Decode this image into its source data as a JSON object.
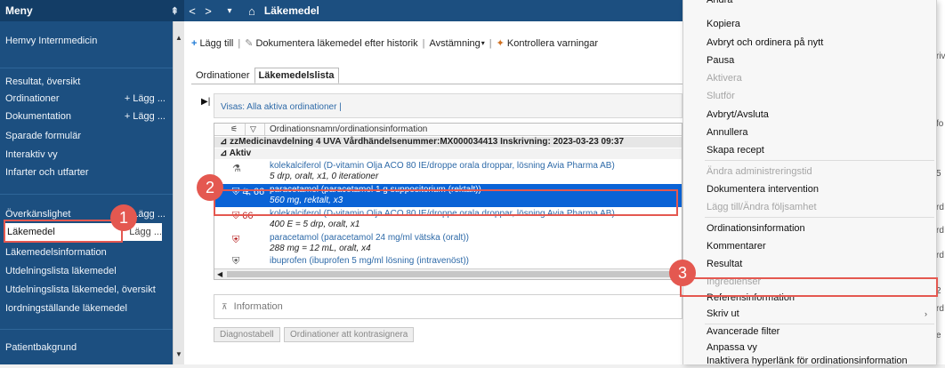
{
  "sidebar": {
    "title": "Meny",
    "pin": "⇞",
    "items": [
      {
        "label": "Hemvy Internmedicin",
        "add": ""
      },
      {
        "label": "Resultat, översikt",
        "add": ""
      },
      {
        "label": "Ordinationer",
        "add": "+ Lägg ..."
      },
      {
        "label": "Dokumentation",
        "add": "+ Lägg ..."
      },
      {
        "label": "Sparade formulär",
        "add": ""
      },
      {
        "label": "Interaktiv vy",
        "add": ""
      },
      {
        "label": "Infarter och utfarter",
        "add": ""
      },
      {
        "label": "Överkänslighet",
        "add": "Lägg ..."
      },
      {
        "label": "Läkemedel",
        "add": "Lägg ..."
      },
      {
        "label": "Läkemedelsinformation",
        "add": ""
      },
      {
        "label": "Utdelningslista läkemedel",
        "add": ""
      },
      {
        "label": "Utdelningslista läkemedel, översikt",
        "add": ""
      },
      {
        "label": "Iordningställande läkemedel",
        "add": ""
      },
      {
        "label": "Patientbakgrund",
        "add": ""
      }
    ]
  },
  "topbar": {
    "back": "<",
    "forward": ">",
    "dropdown": "▾",
    "home": "⌂",
    "title": "Läkemedel"
  },
  "toolbar": {
    "add": "Lägg till",
    "document": "Dokumentera läkemedel efter historik",
    "reconcile": "Avstämning",
    "reconcile_caret": "▾",
    "warnings": "Kontrollera varningar"
  },
  "tabs": {
    "orders": "Ordinationer",
    "medlist": "Läkemedelslista"
  },
  "filter": {
    "play": "▶|",
    "text": "Visas: Alla aktiva ordinationer |"
  },
  "grid": {
    "col1": "⚟",
    "col2": "▽",
    "col3": "Ordinationsnamn/ordinationsinformation",
    "group": "⊿  zzMedicinavdelning 4 UVA  Vårdhändelsenummer:MX000034413  Inskrivning: 2023-03-23 09:37",
    "subgroup": "⊿  Aktiv",
    "rows": [
      {
        "icon": "⚗",
        "l1": "kolekalciferol (D-vitamin Olja ACO 80 IE/droppe orala droppar, lösning Avia Pharma AB)",
        "l2": "5 drp, oralt, x1, 0 iterationer"
      },
      {
        "icon": "⛨ ⛐ 66",
        "l1": "paracetamol (paracetamol 1 g suppositorium (rektalt))",
        "l2": "560 mg, rektalt, x3"
      },
      {
        "icon": "⛨ 66",
        "l1": "kolekalciferol (D-vitamin Olja ACO 80 IE/droppe orala droppar, lösning Avia Pharma AB)",
        "l2": "400 E = 5 drp, oralt, x1"
      },
      {
        "icon": "⛨",
        "l1": "paracetamol (paracetamol 24 mg/ml vätska (oralt))",
        "l2": "288 mg = 12 mL, oralt, x4"
      },
      {
        "icon": "⛨",
        "l1": "ibuprofen (ibuprofen 5 mg/ml lösning (intravenöst))",
        "l2": ""
      }
    ]
  },
  "info": {
    "label": "Information",
    "toggle": "⊼"
  },
  "buttons": {
    "diagnosis": "Diagnostabell",
    "cosign": "Ordinationer att kontrasignera"
  },
  "edge_fragments": [
    "riv",
    "fo",
    "5",
    "rd",
    "rd",
    "rd",
    "2",
    "rd",
    "e"
  ],
  "menu": {
    "items": [
      {
        "label": "Ändra",
        "disabled": false
      },
      {
        "label": "Kopiera",
        "disabled": false
      },
      {
        "label": "Avbryt och ordinera på nytt",
        "disabled": false
      },
      {
        "label": "Pausa",
        "disabled": false
      },
      {
        "label": "Aktivera",
        "disabled": true
      },
      {
        "label": "Slutför",
        "disabled": true
      },
      {
        "label": "Avbryt/Avsluta",
        "disabled": false
      },
      {
        "label": "Annullera",
        "disabled": false
      },
      {
        "label": "Skapa recept",
        "disabled": false
      },
      {
        "label": "Ändra administreringstid",
        "disabled": true
      },
      {
        "label": "Dokumentera intervention",
        "disabled": false
      },
      {
        "label": "Lägg till/Ändra följsamhet",
        "disabled": true
      },
      {
        "label": "Ordinationsinformation",
        "disabled": false
      },
      {
        "label": "Kommentarer",
        "disabled": false
      },
      {
        "label": "Resultat",
        "disabled": false
      },
      {
        "label": "Ingredienser",
        "disabled": true
      },
      {
        "label": "Referensinformation",
        "disabled": false
      },
      {
        "label": "Skriv ut",
        "disabled": false
      },
      {
        "label": "Avancerade filter",
        "disabled": false
      },
      {
        "label": "Anpassa vy",
        "disabled": false
      },
      {
        "label": "Inaktivera hyperlänk för ordinationsinformation",
        "disabled": false
      }
    ],
    "submenu_arrow": "›"
  },
  "callouts": {
    "one": "1",
    "two": "2",
    "three": "3"
  }
}
